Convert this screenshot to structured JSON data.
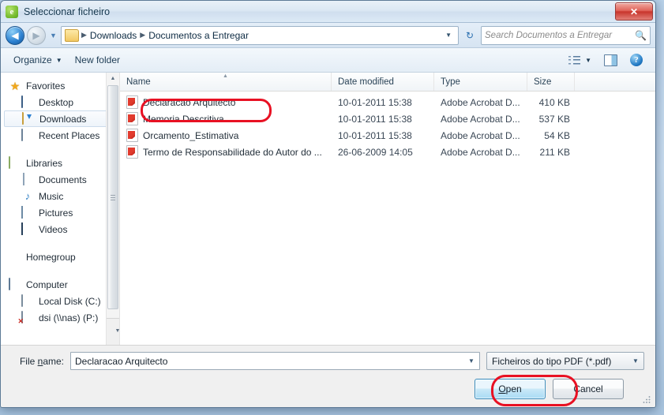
{
  "window": {
    "title": "Seleccionar ficheiro",
    "app_icon": "e",
    "close_label": "✕"
  },
  "address": {
    "back_icon": "◀",
    "forward_icon": "▶",
    "history_caret": "▼",
    "folder_icon": "folder-icon",
    "crumbs": [
      "Downloads",
      "Documentos a Entregar"
    ],
    "separator": "▶",
    "dropdown_caret": "▼",
    "refresh_icon": "↻"
  },
  "search": {
    "placeholder": "Search Documentos a Entregar",
    "icon": "🔍"
  },
  "toolbar": {
    "organize_label": "Organize",
    "organize_caret": "▼",
    "new_folder_label": "New folder",
    "view_caret": "▼",
    "help_label": "?"
  },
  "sidebar": {
    "groups": [
      {
        "header": "Favorites",
        "items": [
          {
            "label": "Desktop",
            "icon": "desktop-icon",
            "selected": false
          },
          {
            "label": "Downloads",
            "icon": "downloads-icon",
            "selected": true
          },
          {
            "label": "Recent Places",
            "icon": "recent-places-icon",
            "selected": false
          }
        ]
      },
      {
        "header": "Libraries",
        "items": [
          {
            "label": "Documents",
            "icon": "documents-icon",
            "selected": false
          },
          {
            "label": "Music",
            "icon": "music-icon",
            "selected": false
          },
          {
            "label": "Pictures",
            "icon": "pictures-icon",
            "selected": false
          },
          {
            "label": "Videos",
            "icon": "videos-icon",
            "selected": false
          }
        ]
      },
      {
        "header": "Homegroup",
        "items": []
      },
      {
        "header": "Computer",
        "items": [
          {
            "label": "Local Disk (C:)",
            "icon": "local-disk-icon",
            "selected": false
          },
          {
            "label": "dsi (\\\\nas) (P:)",
            "icon": "network-drive-disconnected-icon",
            "selected": false
          }
        ]
      }
    ],
    "scroll_up": "▲",
    "scroll_down": "▼"
  },
  "filelist": {
    "columns": {
      "name": "Name",
      "date_modified": "Date modified",
      "type": "Type",
      "size": "Size"
    },
    "sort_indicator": "▲",
    "rows": [
      {
        "name": "Declaracao Arquitecto",
        "date": "10-01-2011 15:38",
        "type": "Adobe Acrobat D...",
        "size": "410 KB"
      },
      {
        "name": "Memoria Descritiva",
        "date": "10-01-2011 15:38",
        "type": "Adobe Acrobat D...",
        "size": "537 KB"
      },
      {
        "name": "Orcamento_Estimativa",
        "date": "10-01-2011 15:38",
        "type": "Adobe Acrobat D...",
        "size": "54 KB"
      },
      {
        "name": "Termo de Responsabilidade do Autor do ...",
        "date": "26-06-2009 14:05",
        "type": "Adobe Acrobat D...",
        "size": "211 KB"
      }
    ]
  },
  "bottom": {
    "filename_label_pre": "File ",
    "filename_label_key": "n",
    "filename_label_post": "ame:",
    "filename_value": "Declaracao Arquitecto",
    "filename_caret": "▼",
    "filter_value": "Ficheiros do tipo PDF (*.pdf)",
    "filter_caret": "▼",
    "open_label_pre": "",
    "open_label_key": "O",
    "open_label_post": "pen",
    "cancel_label": "Cancel"
  },
  "annotations": {
    "highlight_color": "#e81123",
    "marks": [
      "file-row-highlight",
      "open-button-highlight"
    ]
  }
}
